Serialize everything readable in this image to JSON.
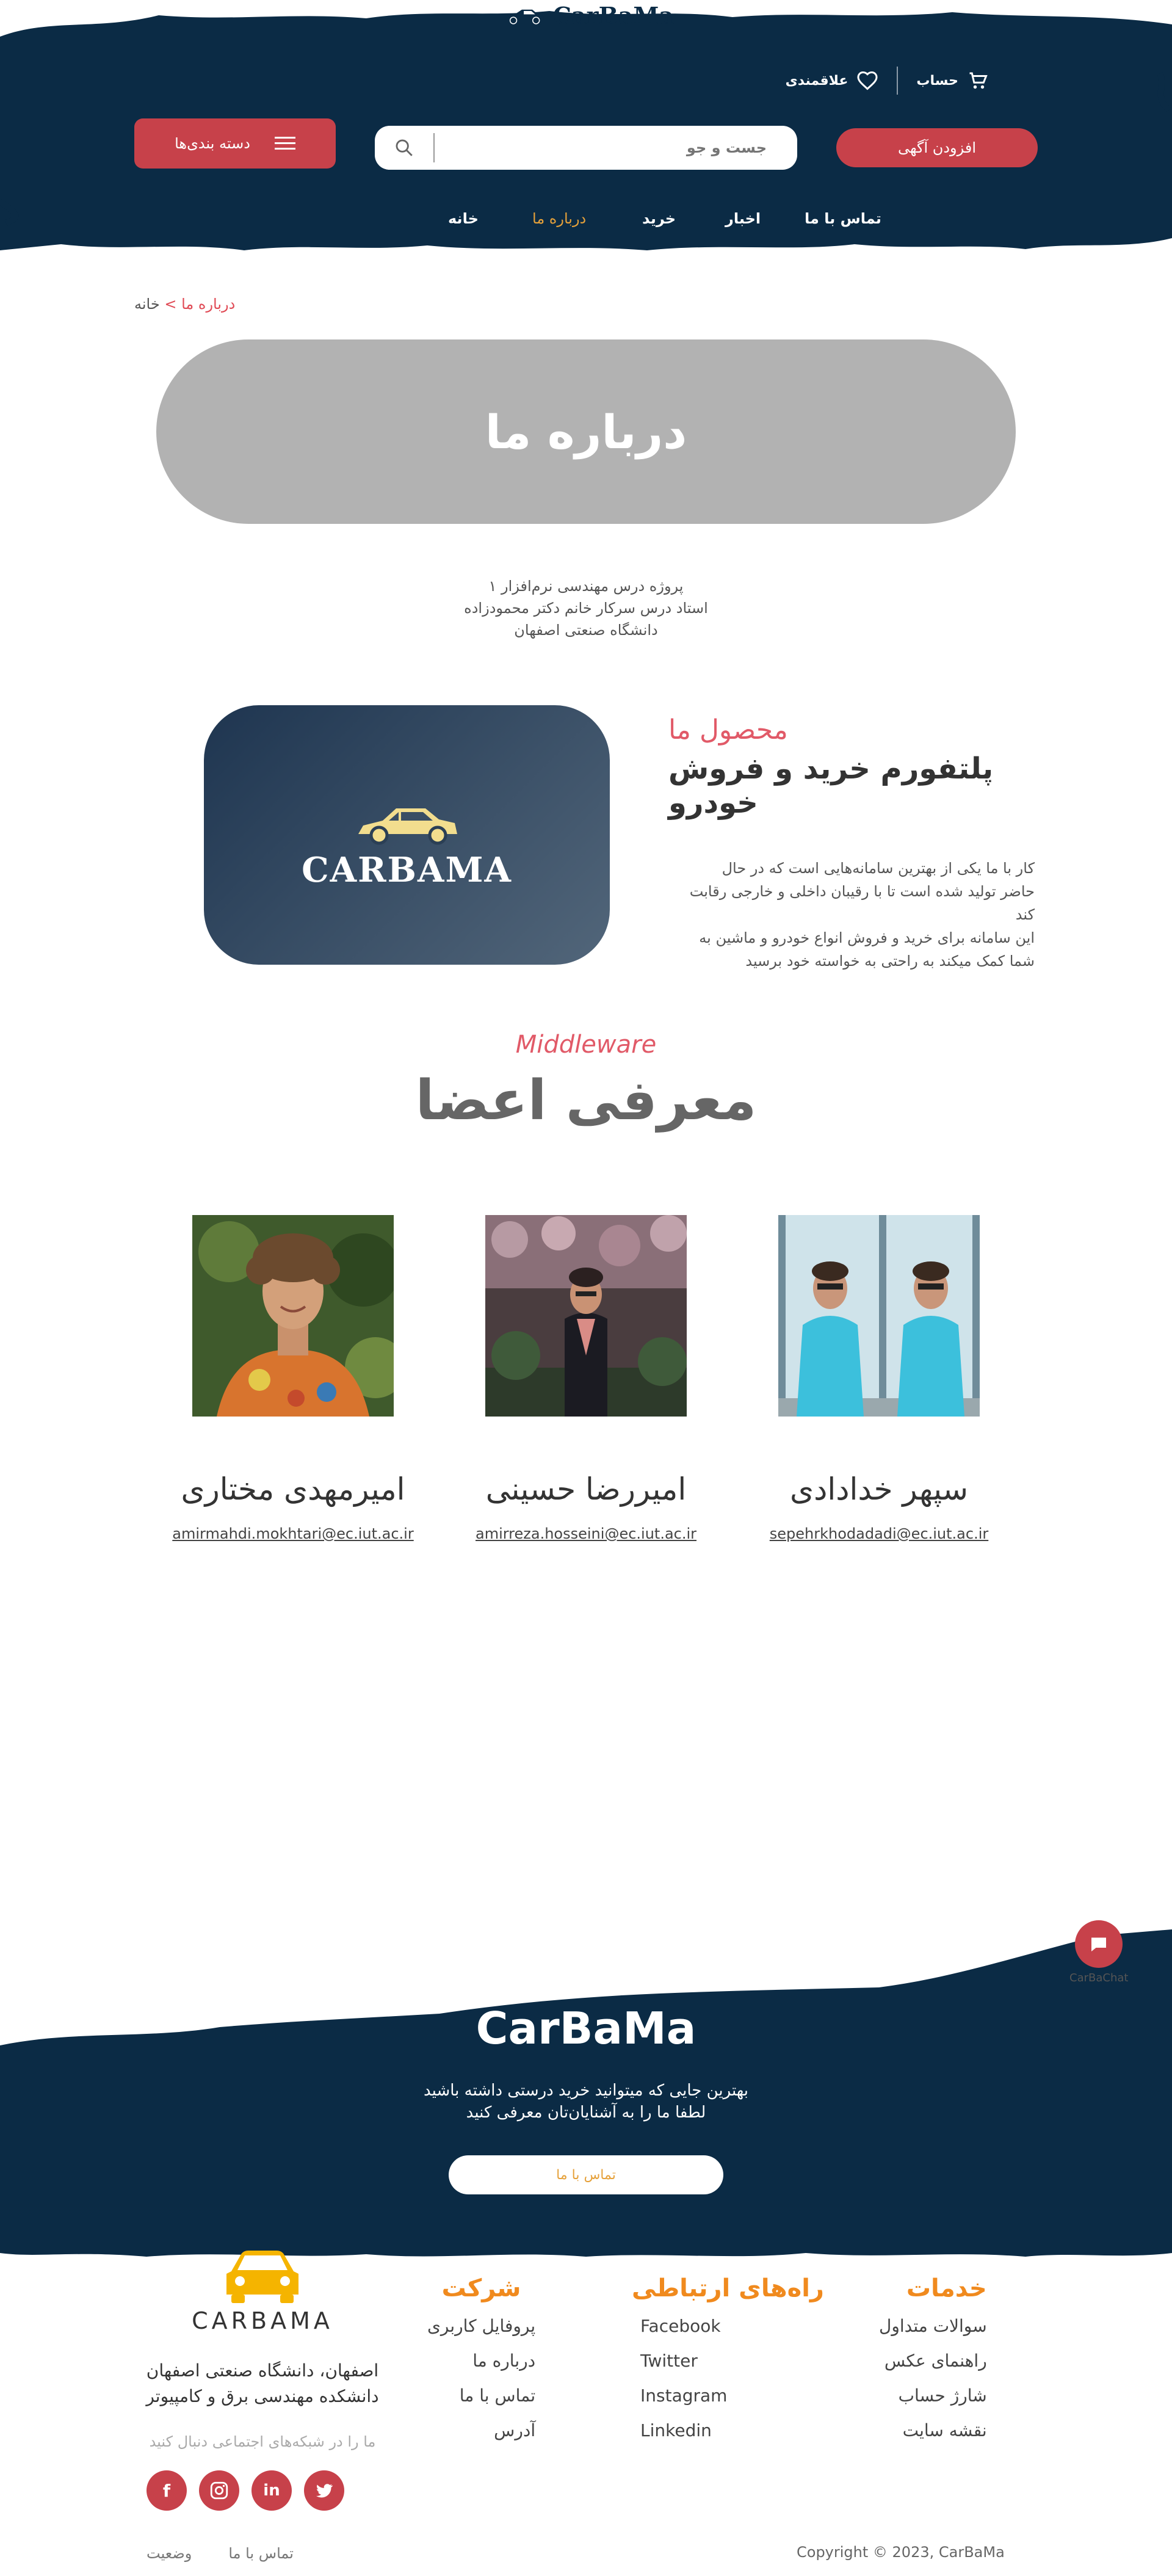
{
  "header": {
    "logo_text": "CarBaMa",
    "account_label": "حساب",
    "favorites_label": "علاقمندی",
    "add_ad_label": "افزودن آگهی",
    "search_placeholder": "جست و جو",
    "categories_label": "دسته بندی‌ها",
    "nav": [
      "تماس با ما",
      "اخبار",
      "خرید",
      "درباره ما",
      "خانه"
    ],
    "nav_active": "درباره ما",
    "brand_color": "#0b2b45",
    "accent_color": "#c7414a"
  },
  "breadcrumb": {
    "home": "خانه",
    "separator": ">",
    "current": "درباره ما"
  },
  "hero": {
    "title": "درباره ما"
  },
  "intro": {
    "lines": [
      "پروژه درس مهندسی نرم‌افزار ۱",
      "استاد درس سرکار خانم دکتر محمودزاده",
      "دانشگاه صنعتی اصفهان"
    ]
  },
  "product": {
    "card_brand": "CARBAMA",
    "eyebrow": "محصول ما",
    "title": "پلتفورم خرید و فروش خودرو",
    "desc": [
      "کار با ما یکی از بهترین سامانه‌هایی است که در حال",
      "حاضر تولید شده است تا با رقیبان داخلی و خارجی رقابت",
      "کند",
      "این سامانه برای خرید و فروش انواع خودرو و ماشین به",
      "شما کمک میکند به راحتی به خواسته خود برسید"
    ]
  },
  "members": {
    "eyebrow": "Middleware",
    "title": "معرفی اعضا",
    "list": [
      {
        "name": "امیرمهدی مختاری",
        "email": "amirmahdi.mokhtari@ec.iut.ac.ir"
      },
      {
        "name": "امیررضا حسینی",
        "email": "amirreza.hosseini@ec.iut.ac.ir"
      },
      {
        "name": "سپهر خدادادی",
        "email": "sepehrkhodadadi@ec.iut.ac.ir"
      }
    ]
  },
  "chat": {
    "label": "CarBaChat"
  },
  "footer": {
    "brand": "CarBaMa",
    "tagline": [
      "بهترین جایی که میتوانید خرید درستی داشته باشید",
      "لطفا ما را به آشنایان‌تان معرفی کنید"
    ],
    "contact_button": "تماس با ما",
    "logo_text": "CARBAMA",
    "address": [
      "اصفهان، دانشگاه صنعتی اصفهان",
      "دانشکده مهندسی برق و کامپیوتر"
    ],
    "social_label": "ما را در شبکه‌های اجتماعی دنبال کنید",
    "company": {
      "title": "شرکت",
      "items": [
        "پروفایل کاربری",
        "درباره ما",
        "تماس با ما",
        "آدرس"
      ]
    },
    "contact": {
      "title": "راه‌های ارتباطی",
      "items": [
        "Facebook",
        "Twitter",
        "Instagram",
        "Linkedin"
      ]
    },
    "services": {
      "title": "خدمات",
      "items": [
        "سوالات متداول",
        "راهنمای عکس",
        "شارژ حساب",
        "نقشه سایت"
      ]
    },
    "bottom_links": [
      "وضعیت",
      "تماس با ما"
    ],
    "copyright": "Copyright © 2023, CarBaMa"
  }
}
